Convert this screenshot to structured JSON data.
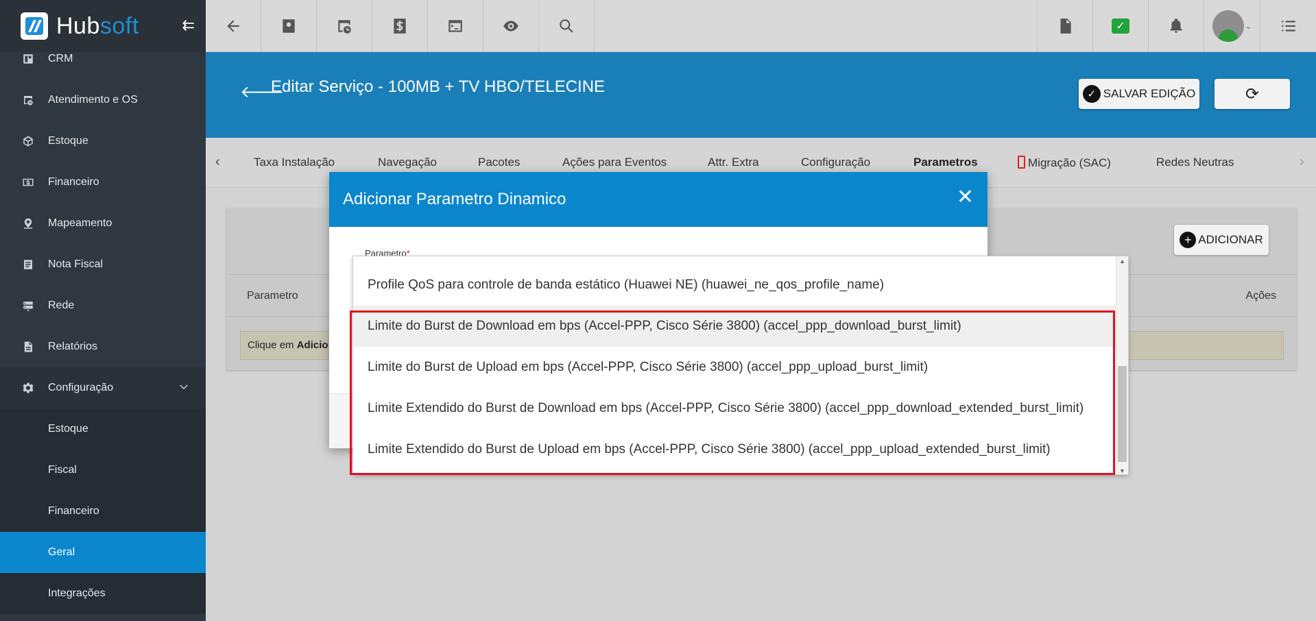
{
  "brand": {
    "name_part1": "Hub",
    "name_part2": "soft"
  },
  "sidebar": {
    "items": [
      {
        "label": "CRM"
      },
      {
        "label": "Atendimento e OS"
      },
      {
        "label": "Estoque"
      },
      {
        "label": "Financeiro"
      },
      {
        "label": "Mapeamento"
      },
      {
        "label": "Nota Fiscal"
      },
      {
        "label": "Rede"
      },
      {
        "label": "Relatórios"
      },
      {
        "label": "Configuração"
      }
    ],
    "sub_items": [
      {
        "label": "Estoque"
      },
      {
        "label": "Fiscal"
      },
      {
        "label": "Financeiro"
      },
      {
        "label": "Geral"
      },
      {
        "label": "Integrações"
      }
    ]
  },
  "header": {
    "title": "Editar Serviço - 100MB + TV HBO/TELECINE",
    "save_label": "SALVAR EDIÇÃO"
  },
  "tabs": [
    {
      "label": "Taxa Instalação"
    },
    {
      "label": "Navegação"
    },
    {
      "label": "Pacotes"
    },
    {
      "label": "Ações para Eventos"
    },
    {
      "label": "Attr. Extra"
    },
    {
      "label": "Configuração"
    },
    {
      "label": "Parametros"
    },
    {
      "label": "Migração (SAC)"
    },
    {
      "label": "Redes Neutras"
    }
  ],
  "card": {
    "add_label": "ADICIONAR",
    "col_param": "Parametro",
    "col_acoes": "Ações",
    "hint_prefix": "Clique em ",
    "hint_bold": "Adicio"
  },
  "modal": {
    "title": "Adicionar Parametro Dinamico",
    "field_label": "Parametro",
    "required_mark": "*"
  },
  "dropdown": {
    "options": [
      {
        "label": "Profile QoS para controle de banda estático (Huawei NE) (huawei_ne_qos_profile_name)"
      },
      {
        "label": "Limite do Burst de Download em bps (Accel-PPP, Cisco Série 3800) (accel_ppp_download_burst_limit)"
      },
      {
        "label": "Limite do Burst de Upload em bps (Accel-PPP, Cisco Série 3800) (accel_ppp_upload_burst_limit)"
      },
      {
        "label": "Limite Extendido do Burst de Download em bps (Accel-PPP, Cisco Série 3800) (accel_ppp_download_extended_burst_limit)"
      },
      {
        "label": "Limite Extendido do Burst de Upload em bps (Accel-PPP, Cisco Série 3800) (accel_ppp_upload_extended_burst_limit)"
      }
    ]
  },
  "colors": {
    "primary": "#0a86cd",
    "header_blue": "#1a7fb8",
    "sidebar": "#2f3740",
    "highlight": "#e3101a"
  }
}
